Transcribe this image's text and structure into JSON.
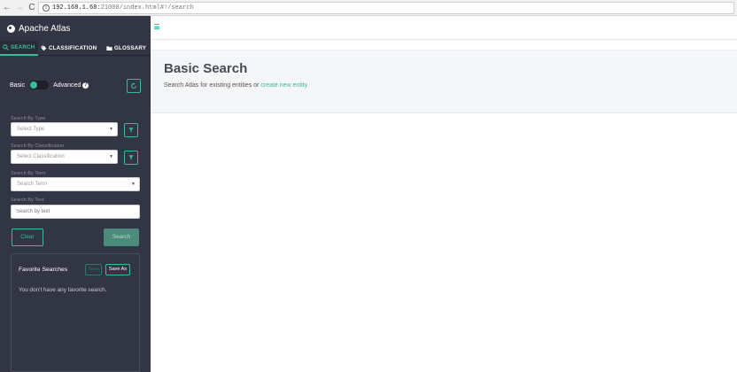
{
  "browser": {
    "back": "←",
    "forward": "→",
    "reload": "C",
    "url_host": "192.168.1.68",
    "url_rest": ":21000/index.html#!/search"
  },
  "sidebar": {
    "brand": "Apache Atlas",
    "tabs": [
      {
        "label": "SEARCH",
        "icon": "search-icon"
      },
      {
        "label": "CLASSIFICATION",
        "icon": "tag-icon"
      },
      {
        "label": "GLOSSARY",
        "icon": "folder-icon"
      }
    ],
    "toggle": {
      "basic": "Basic",
      "advanced": "Advanced",
      "help": "?"
    },
    "search_by_type": {
      "label": "Search By Type",
      "placeholder": "Select Type"
    },
    "search_by_classification": {
      "label": "Search By Classification",
      "placeholder": "Select Classification"
    },
    "search_by_term": {
      "label": "Search By Term",
      "placeholder": "Search Term"
    },
    "search_by_text": {
      "label": "Search By Text",
      "placeholder": "Search by text"
    },
    "clear_label": "Clear",
    "search_label": "Search",
    "favorites": {
      "title": "Favorite Searches",
      "save_label": "Save",
      "save_as_label": "Save As",
      "empty_text": "You don't have any favorite search."
    }
  },
  "main": {
    "title": "Basic Search",
    "subtitle": "Search Atlas for existing entities or ",
    "create_link": "create new entity"
  },
  "colors": {
    "accent": "#38bb9b",
    "sidebar_bg": "#323544"
  }
}
